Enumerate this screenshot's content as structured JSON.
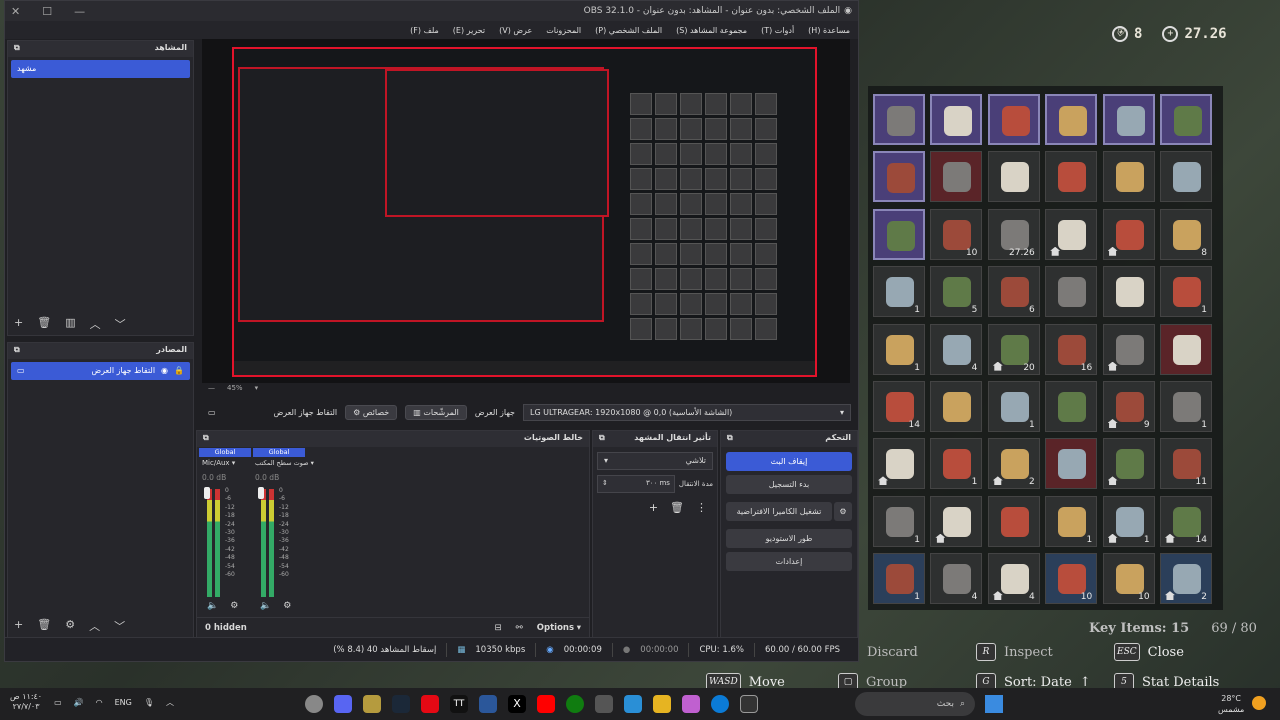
{
  "game": {
    "hud_shield": "8",
    "hud_money": "27.26",
    "key_items_label": "Key Items: 15",
    "capacity": "69 / 80",
    "hints": [
      {
        "key": "",
        "label": "Discard"
      },
      {
        "key": "R",
        "label": "Inspect"
      },
      {
        "key": "ESC",
        "label": "Close"
      },
      {
        "key": "WASD",
        "label": "Move"
      },
      {
        "key": "",
        "label": "Group"
      },
      {
        "key": "G",
        "label": "Sort: Date"
      },
      {
        "key": "5",
        "label": "Stat Details"
      }
    ],
    "counts": [
      "",
      "",
      "",
      "",
      "",
      "",
      "",
      "",
      "",
      "",
      "",
      "",
      "",
      "10",
      "27.26",
      "",
      "",
      "8",
      "1",
      "5",
      "6",
      "",
      "",
      "1",
      "1",
      "4",
      "20",
      "16",
      "",
      "",
      "14",
      "",
      "1",
      "",
      "9",
      "1",
      "",
      "1",
      "2",
      "",
      "",
      "11",
      "1",
      "",
      "",
      "1",
      "1",
      "14",
      "1",
      "4",
      "4",
      "10",
      "10",
      "2"
    ]
  },
  "obs": {
    "title": "OBS 32.1.0 - الملف الشخصي: بدون عنوان - المشاهد: بدون عنوان",
    "menu": [
      "ملف (F)",
      "تحرير (E)",
      "عرض (V)",
      "المحزونات",
      "الملف الشخصي (P)",
      "مجموعة المشاهد (S)",
      "أدوات (T)",
      "مساعدة (H)"
    ],
    "scenes_title": "المشاهد",
    "scene_item": "مشهد",
    "sources_title": "المصادر",
    "source_item": "التقاط جهاز العرض",
    "zoom": "45%",
    "source_bar": {
      "name": "التقاط جهاز العرض",
      "props": "خصائص",
      "filters": "المرشّحات",
      "device_label": "جهاز العرض",
      "device_value": "LG ULTRAGEAR: 1920x1080 @ 0,0 (الشاشة الأساسية)"
    },
    "mixer": {
      "title": "خالط الصوتيات",
      "ch1_tag": "Global",
      "ch1_name": "Mic/Aux",
      "ch1_db": "0.0 dB",
      "ch2_tag": "Global",
      "ch2_name": "صوت سطح المكتب",
      "ch2_db": "0.0 dB",
      "scale": [
        "0",
        "-6",
        "-12",
        "-18",
        "-24",
        "-30",
        "-36",
        "-42",
        "-48",
        "-54",
        "-60"
      ],
      "hidden": "0 hidden",
      "options": "Options"
    },
    "transitions": {
      "title": "تأثير انتقال المشهد",
      "type": "تلاشي",
      "duration_label": "مدة الانتقال",
      "duration_value": "٣٠٠ ms"
    },
    "controls": {
      "title": "التحكم",
      "stop_stream": "إيقاف البث",
      "start_record": "بدء التسجيل",
      "virtual_cam": "تشغيل الكاميرا الافتراضية",
      "studio": "طور الاستوديو",
      "settings": "إعدادات"
    },
    "status": {
      "dropped": "إسقاط المشاهد 40 (8.4 %)",
      "bitrate": "10350 kbps",
      "stream_time": "00:00:09",
      "rec_time": "00:00:00",
      "cpu": "CPU: 1.6%",
      "fps": "60.00 / 60.00 FPS"
    }
  },
  "taskbar": {
    "search": "بحث",
    "lang": "ENG",
    "time": "١١:٤٠ ص",
    "date": "٢٧/٧/٠٣",
    "temp": "28°C",
    "weather": "مشمس"
  },
  "colors": {
    "accent": "#3b5bd6",
    "record_border": "#e2132b"
  }
}
